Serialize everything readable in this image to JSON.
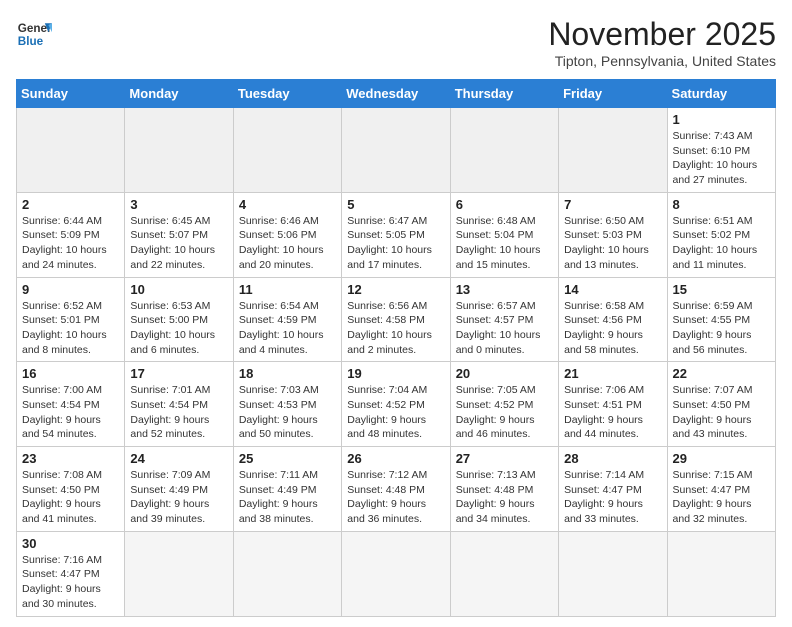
{
  "header": {
    "logo_general": "General",
    "logo_blue": "Blue",
    "month_title": "November 2025",
    "location": "Tipton, Pennsylvania, United States"
  },
  "days_of_week": [
    "Sunday",
    "Monday",
    "Tuesday",
    "Wednesday",
    "Thursday",
    "Friday",
    "Saturday"
  ],
  "weeks": [
    [
      {
        "day": "",
        "info": ""
      },
      {
        "day": "",
        "info": ""
      },
      {
        "day": "",
        "info": ""
      },
      {
        "day": "",
        "info": ""
      },
      {
        "day": "",
        "info": ""
      },
      {
        "day": "",
        "info": ""
      },
      {
        "day": "1",
        "info": "Sunrise: 7:43 AM\nSunset: 6:10 PM\nDaylight: 10 hours and 27 minutes."
      }
    ],
    [
      {
        "day": "2",
        "info": "Sunrise: 6:44 AM\nSunset: 5:09 PM\nDaylight: 10 hours and 24 minutes."
      },
      {
        "day": "3",
        "info": "Sunrise: 6:45 AM\nSunset: 5:07 PM\nDaylight: 10 hours and 22 minutes."
      },
      {
        "day": "4",
        "info": "Sunrise: 6:46 AM\nSunset: 5:06 PM\nDaylight: 10 hours and 20 minutes."
      },
      {
        "day": "5",
        "info": "Sunrise: 6:47 AM\nSunset: 5:05 PM\nDaylight: 10 hours and 17 minutes."
      },
      {
        "day": "6",
        "info": "Sunrise: 6:48 AM\nSunset: 5:04 PM\nDaylight: 10 hours and 15 minutes."
      },
      {
        "day": "7",
        "info": "Sunrise: 6:50 AM\nSunset: 5:03 PM\nDaylight: 10 hours and 13 minutes."
      },
      {
        "day": "8",
        "info": "Sunrise: 6:51 AM\nSunset: 5:02 PM\nDaylight: 10 hours and 11 minutes."
      }
    ],
    [
      {
        "day": "9",
        "info": "Sunrise: 6:52 AM\nSunset: 5:01 PM\nDaylight: 10 hours and 8 minutes."
      },
      {
        "day": "10",
        "info": "Sunrise: 6:53 AM\nSunset: 5:00 PM\nDaylight: 10 hours and 6 minutes."
      },
      {
        "day": "11",
        "info": "Sunrise: 6:54 AM\nSunset: 4:59 PM\nDaylight: 10 hours and 4 minutes."
      },
      {
        "day": "12",
        "info": "Sunrise: 6:56 AM\nSunset: 4:58 PM\nDaylight: 10 hours and 2 minutes."
      },
      {
        "day": "13",
        "info": "Sunrise: 6:57 AM\nSunset: 4:57 PM\nDaylight: 10 hours and 0 minutes."
      },
      {
        "day": "14",
        "info": "Sunrise: 6:58 AM\nSunset: 4:56 PM\nDaylight: 9 hours and 58 minutes."
      },
      {
        "day": "15",
        "info": "Sunrise: 6:59 AM\nSunset: 4:55 PM\nDaylight: 9 hours and 56 minutes."
      }
    ],
    [
      {
        "day": "16",
        "info": "Sunrise: 7:00 AM\nSunset: 4:54 PM\nDaylight: 9 hours and 54 minutes."
      },
      {
        "day": "17",
        "info": "Sunrise: 7:01 AM\nSunset: 4:54 PM\nDaylight: 9 hours and 52 minutes."
      },
      {
        "day": "18",
        "info": "Sunrise: 7:03 AM\nSunset: 4:53 PM\nDaylight: 9 hours and 50 minutes."
      },
      {
        "day": "19",
        "info": "Sunrise: 7:04 AM\nSunset: 4:52 PM\nDaylight: 9 hours and 48 minutes."
      },
      {
        "day": "20",
        "info": "Sunrise: 7:05 AM\nSunset: 4:52 PM\nDaylight: 9 hours and 46 minutes."
      },
      {
        "day": "21",
        "info": "Sunrise: 7:06 AM\nSunset: 4:51 PM\nDaylight: 9 hours and 44 minutes."
      },
      {
        "day": "22",
        "info": "Sunrise: 7:07 AM\nSunset: 4:50 PM\nDaylight: 9 hours and 43 minutes."
      }
    ],
    [
      {
        "day": "23",
        "info": "Sunrise: 7:08 AM\nSunset: 4:50 PM\nDaylight: 9 hours and 41 minutes."
      },
      {
        "day": "24",
        "info": "Sunrise: 7:09 AM\nSunset: 4:49 PM\nDaylight: 9 hours and 39 minutes."
      },
      {
        "day": "25",
        "info": "Sunrise: 7:11 AM\nSunset: 4:49 PM\nDaylight: 9 hours and 38 minutes."
      },
      {
        "day": "26",
        "info": "Sunrise: 7:12 AM\nSunset: 4:48 PM\nDaylight: 9 hours and 36 minutes."
      },
      {
        "day": "27",
        "info": "Sunrise: 7:13 AM\nSunset: 4:48 PM\nDaylight: 9 hours and 34 minutes."
      },
      {
        "day": "28",
        "info": "Sunrise: 7:14 AM\nSunset: 4:47 PM\nDaylight: 9 hours and 33 minutes."
      },
      {
        "day": "29",
        "info": "Sunrise: 7:15 AM\nSunset: 4:47 PM\nDaylight: 9 hours and 32 minutes."
      }
    ],
    [
      {
        "day": "30",
        "info": "Sunrise: 7:16 AM\nSunset: 4:47 PM\nDaylight: 9 hours and 30 minutes."
      },
      {
        "day": "",
        "info": ""
      },
      {
        "day": "",
        "info": ""
      },
      {
        "day": "",
        "info": ""
      },
      {
        "day": "",
        "info": ""
      },
      {
        "day": "",
        "info": ""
      },
      {
        "day": "",
        "info": ""
      }
    ]
  ]
}
